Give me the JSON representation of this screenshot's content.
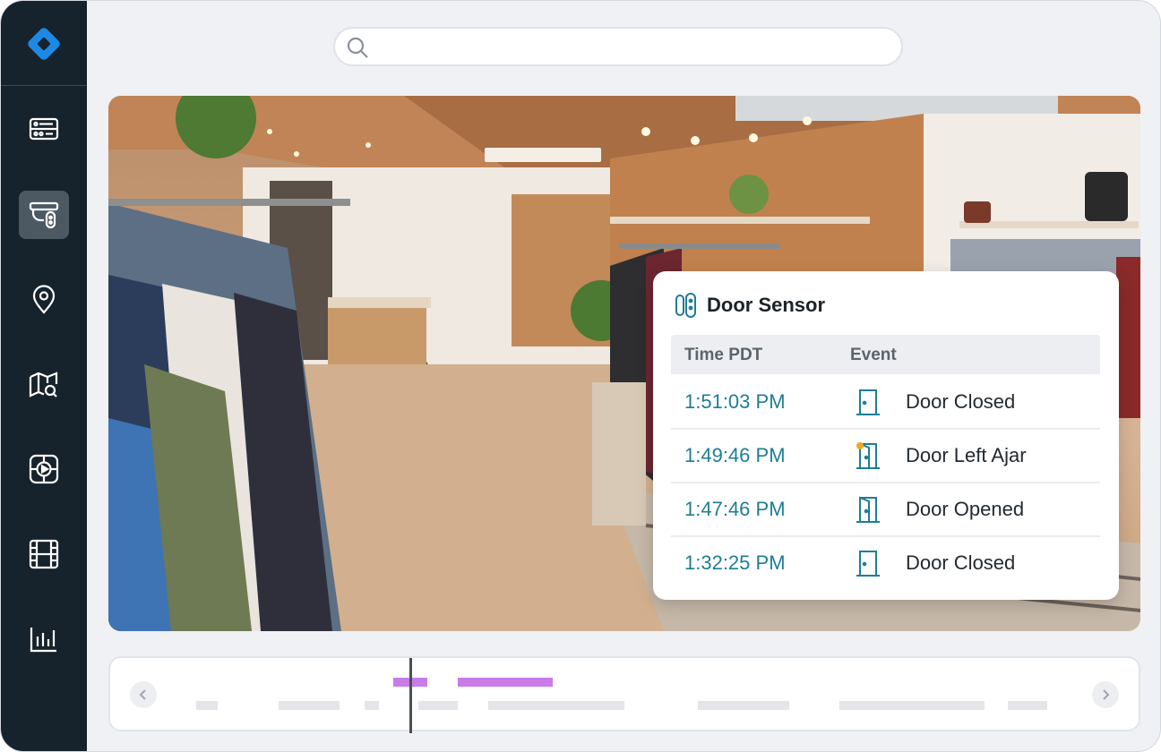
{
  "search": {
    "placeholder": ""
  },
  "nav": {
    "items": [
      {
        "icon": "dashboard-icon",
        "active": false
      },
      {
        "icon": "camera-sensor-icon",
        "active": true
      },
      {
        "icon": "location-pin-icon",
        "active": false
      },
      {
        "icon": "map-search-icon",
        "active": false
      },
      {
        "icon": "video-playback-icon",
        "active": false
      },
      {
        "icon": "film-icon",
        "active": false
      },
      {
        "icon": "report-chart-icon",
        "active": false
      }
    ]
  },
  "sensor_card": {
    "title": "Door Sensor",
    "columns": {
      "time": "Time PDT",
      "event": "Event"
    },
    "rows": [
      {
        "time": "1:51:03 PM",
        "event": "Door Closed",
        "icon": "door-closed-icon"
      },
      {
        "time": "1:49:46 PM",
        "event": "Door Left Ajar",
        "icon": "door-ajar-alert-icon"
      },
      {
        "time": "1:47:46 PM",
        "event": "Door Opened",
        "icon": "door-open-icon"
      },
      {
        "time": "1:32:25 PM",
        "event": "Door Closed",
        "icon": "door-closed-icon"
      }
    ]
  },
  "colors": {
    "sidebar": "#17232c",
    "accent": "#1e7d95",
    "logo": "#1e88e5",
    "timeline_event": "#c97be8",
    "alert": "#f5a623"
  }
}
